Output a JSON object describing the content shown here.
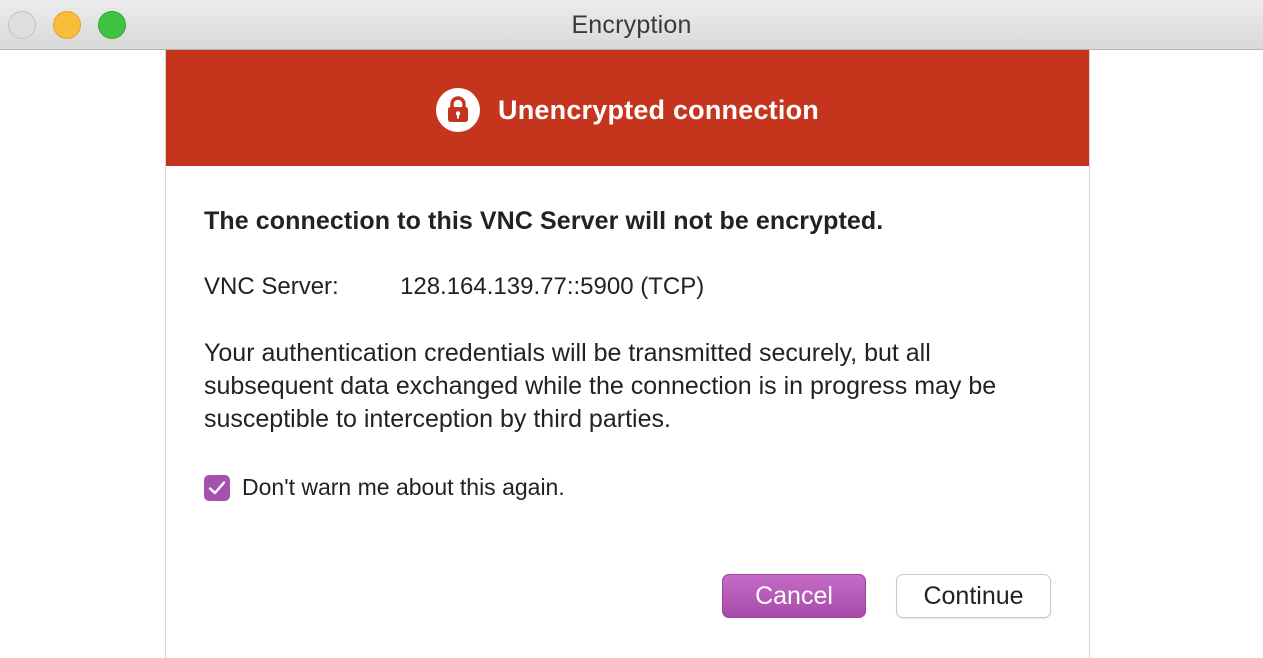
{
  "window": {
    "title": "Encryption"
  },
  "banner": {
    "title": "Unencrypted connection",
    "color": "#c5341d",
    "icon": "lock-icon"
  },
  "body": {
    "heading": "The connection to this VNC Server will not be encrypted.",
    "server_label": "VNC Server:",
    "server_value": "128.164.139.77::5900 (TCP)",
    "description": "Your authentication credentials will be transmitted securely, but all subsequent data exchanged while the connection is in progress may be susceptible to interception by third parties."
  },
  "checkbox": {
    "label": "Don't warn me about this again.",
    "checked": true,
    "accent": "#a552ad"
  },
  "buttons": {
    "cancel_label": "Cancel",
    "continue_label": "Continue"
  }
}
